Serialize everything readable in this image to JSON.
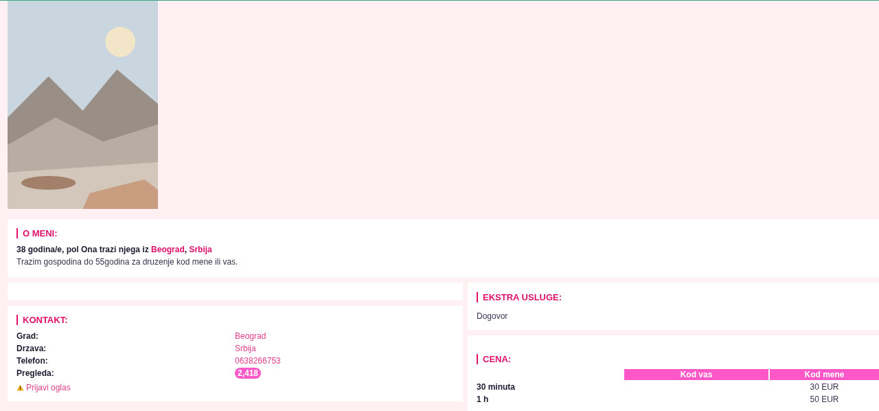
{
  "about": {
    "title": "O MENI:",
    "summary": "38 godina/e, pol Ona trazi njega iz **Beograd**, **Srbija**",
    "text": "Trazim gospodina do 55godina za druzenje kod mene ili vas."
  },
  "contact": {
    "title": "KONTAKT:",
    "fields": [
      {
        "label": "Grad:",
        "value": "Beograd"
      },
      {
        "label": "Drzava:",
        "value": "Srbija"
      },
      {
        "label": "Telefon:",
        "value": "0638266753"
      }
    ],
    "views_label": "Pregleda:",
    "views": "2,418",
    "report_link": "Prijavi oglas"
  },
  "extra": {
    "title": "EKSTRA USLUGE:",
    "text": "Dogovor"
  },
  "price": {
    "title": "CENA:",
    "columns": [
      "Kod vas",
      "Kod mene"
    ],
    "rows": [
      {
        "duration": "30 minuta",
        "kod_mene": "30 EUR"
      },
      {
        "duration": "1 h",
        "kod_mene": "50 EUR"
      }
    ]
  }
}
